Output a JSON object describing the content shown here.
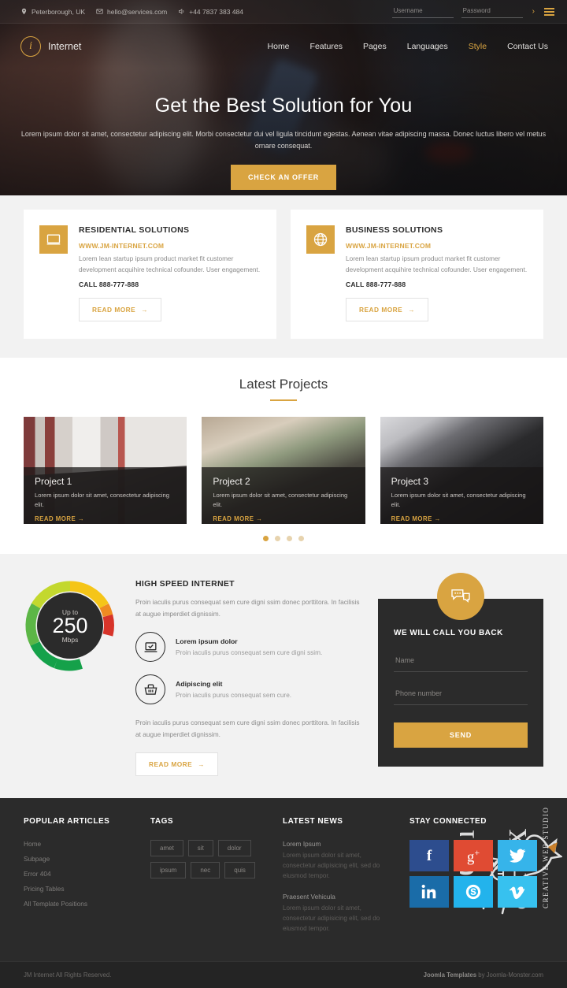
{
  "topbar": {
    "location": "Peterborough, UK",
    "email": "hello@services.com",
    "phone": "+44 7837 383 484",
    "username_placeholder": "Username",
    "password_placeholder": "Password",
    "username_value": "",
    "password_value": "",
    "submit_arrow": "›"
  },
  "brand": {
    "mark": "i",
    "name": "Internet"
  },
  "nav": [
    {
      "label": "Home",
      "active": false
    },
    {
      "label": "Features",
      "active": false
    },
    {
      "label": "Pages",
      "active": false
    },
    {
      "label": "Languages",
      "active": false
    },
    {
      "label": "Style",
      "active": true
    },
    {
      "label": "Contact Us",
      "active": false
    }
  ],
  "hero": {
    "title": "Get the Best Solution for You",
    "subtitle": "Lorem ipsum dolor sit amet, consectetur adipiscing elit. Morbi consectetur dui vel ligula tincidunt egestas. Aenean vitae adipiscing massa. Donec luctus libero vel metus ornare consequat.",
    "cta": "CHECK AN OFFER"
  },
  "services": [
    {
      "icon": "monitor-icon",
      "title": "RESIDENTIAL SOLUTIONS",
      "url": "WWW.JM-INTERNET.COM",
      "desc": "Lorem lean startup ipsum product market fit customer development acquihire technical cofounder. User engagement.",
      "call": "CALL 888-777-888",
      "button": "READ MORE"
    },
    {
      "icon": "globe-icon",
      "title": "BUSINESS SOLUTIONS",
      "url": "WWW.JM-INTERNET.COM",
      "desc": "Lorem lean startup ipsum product market fit customer development acquihire technical cofounder. User engagement.",
      "call": "CALL 888-777-888",
      "button": "READ MORE"
    }
  ],
  "projects": {
    "heading": "Latest Projects",
    "items": [
      {
        "name": "Project 1",
        "desc": "Lorem ipsum dolor sit amet, consectetur adipiscing elit.",
        "link": "READ MORE"
      },
      {
        "name": "Project 2",
        "desc": "Lorem ipsum dolor sit amet, consectetur adipiscing elit.",
        "link": "READ MORE"
      },
      {
        "name": "Project 3",
        "desc": "Lorem ipsum dolor sit amet, consectetur adipiscing elit.",
        "link": "READ MORE"
      }
    ],
    "dots": 4,
    "active_dot": 0
  },
  "speed": {
    "gauge": {
      "upto": "Up to",
      "value": "250",
      "unit": "Mbps"
    },
    "title": "HIGH SPEED INTERNET",
    "intro": "Proin iaculis purus consequat sem cure digni ssim donec porttitora. In facilisis at augue imperdiet dignissim.",
    "features": [
      {
        "icon": "laptop-check-icon",
        "heading": "Lorem ipsum dolor",
        "desc": "Proin iaculis purus consequat sem cure digni ssim."
      },
      {
        "icon": "basket-icon",
        "heading": "Adipiscing elit",
        "desc": "Proin iaculis purus consequat sem cure."
      }
    ],
    "outro": "Proin iaculis purus consequat sem cure digni ssim donec porttitora. In facilisis at augue imperdiet dignissim.",
    "button": "READ MORE"
  },
  "callback": {
    "icon": "chat-bubble-icon",
    "title": "WE WILL CALL YOU BACK",
    "name_placeholder": "Name",
    "name_value": "",
    "phone_placeholder": "Phone number",
    "phone_value": "",
    "send": "SEND"
  },
  "footer": {
    "articles": {
      "title": "POPULAR ARTICLES",
      "links": [
        "Home",
        "Subpage",
        "Error 404",
        "Pricing Tables",
        "All Template Positions"
      ]
    },
    "tags": {
      "title": "TAGS",
      "items": [
        "amet",
        "sit",
        "dolor",
        "ipsum",
        "nec",
        "quis"
      ]
    },
    "news": {
      "title": "LATEST NEWS",
      "items": [
        {
          "heading": "Lorem Ipsum",
          "desc": "Lorem ipsum dolor sit amet, consectetur adipisicing elit, sed do eiusmod tempor."
        },
        {
          "heading": "Praesent Vehicula",
          "desc": "Lorem ipsum dolor sit amet, consectetur adipisicing elit, sed do eiusmod tempor."
        }
      ]
    },
    "social": {
      "title": "STAY CONNECTED",
      "items": [
        {
          "name": "facebook-icon",
          "label": "f",
          "color": "#2d4d8e"
        },
        {
          "name": "google-plus-icon",
          "label": "g+",
          "color": "#e04b33"
        },
        {
          "name": "twitter-icon",
          "label": "t",
          "color": "#36b4ea"
        },
        {
          "name": "linkedin-icon",
          "label": "in",
          "color": "#1а6ca8"
        },
        {
          "name": "skype-icon",
          "label": "s",
          "color": "#23b3ec"
        },
        {
          "name": "vimeo-icon",
          "label": "v",
          "color": "#37c1ef"
        }
      ]
    },
    "watermark": {
      "name": "JoomlaFox",
      "tagline": "CREATIVE WEB STUDIO"
    }
  },
  "copyright": {
    "left": "JM Internet All Rights Reserved.",
    "right_bold": "Joomla Templates",
    "right_rest": " by Joomla-Monster.com"
  },
  "colors": {
    "accent": "#d9a441",
    "dark": "#2b2b2b",
    "light_bg": "#f2f2f2"
  }
}
